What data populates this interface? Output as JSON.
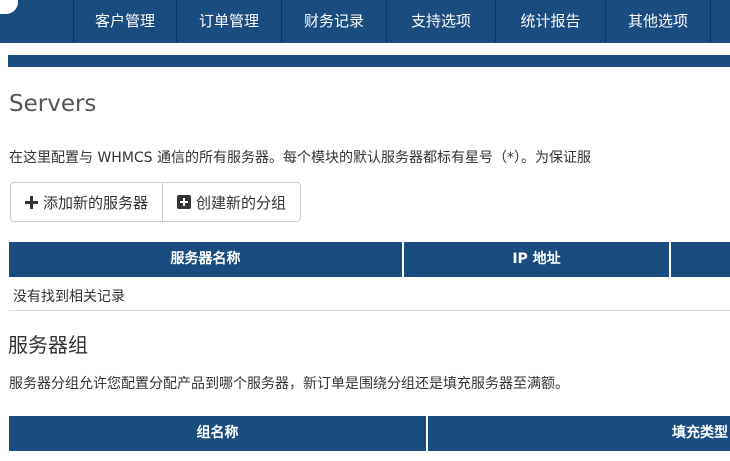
{
  "nav": {
    "items": [
      {
        "label": "客户管理"
      },
      {
        "label": "订单管理"
      },
      {
        "label": "财务记录"
      },
      {
        "label": "支持选项"
      },
      {
        "label": "统计报告"
      },
      {
        "label": "其他选项"
      }
    ]
  },
  "page": {
    "title": "Servers",
    "description": "在这里配置与 WHMCS 通信的所有服务器。每个模块的默认服务器都标有星号（*）。为保证服"
  },
  "toolbar": {
    "add_server_label": "添加新的服务器",
    "create_group_label": "创建新的分组",
    "add_icon": "plus-icon",
    "group_icon": "plus-square-icon"
  },
  "servers_table": {
    "columns": [
      "服务器名称",
      "IP 地址"
    ],
    "empty_text": "没有找到相关记录"
  },
  "groups": {
    "title": "服务器组",
    "description": "服务器分组允许您配置分配产品到哪个服务器，新订单是围绕分组还是填充服务器至满额。",
    "columns": [
      "组名称",
      "填充类型"
    ]
  },
  "colors": {
    "nav_bg": "#1a4c80",
    "header_bg": "#1a4c80"
  }
}
